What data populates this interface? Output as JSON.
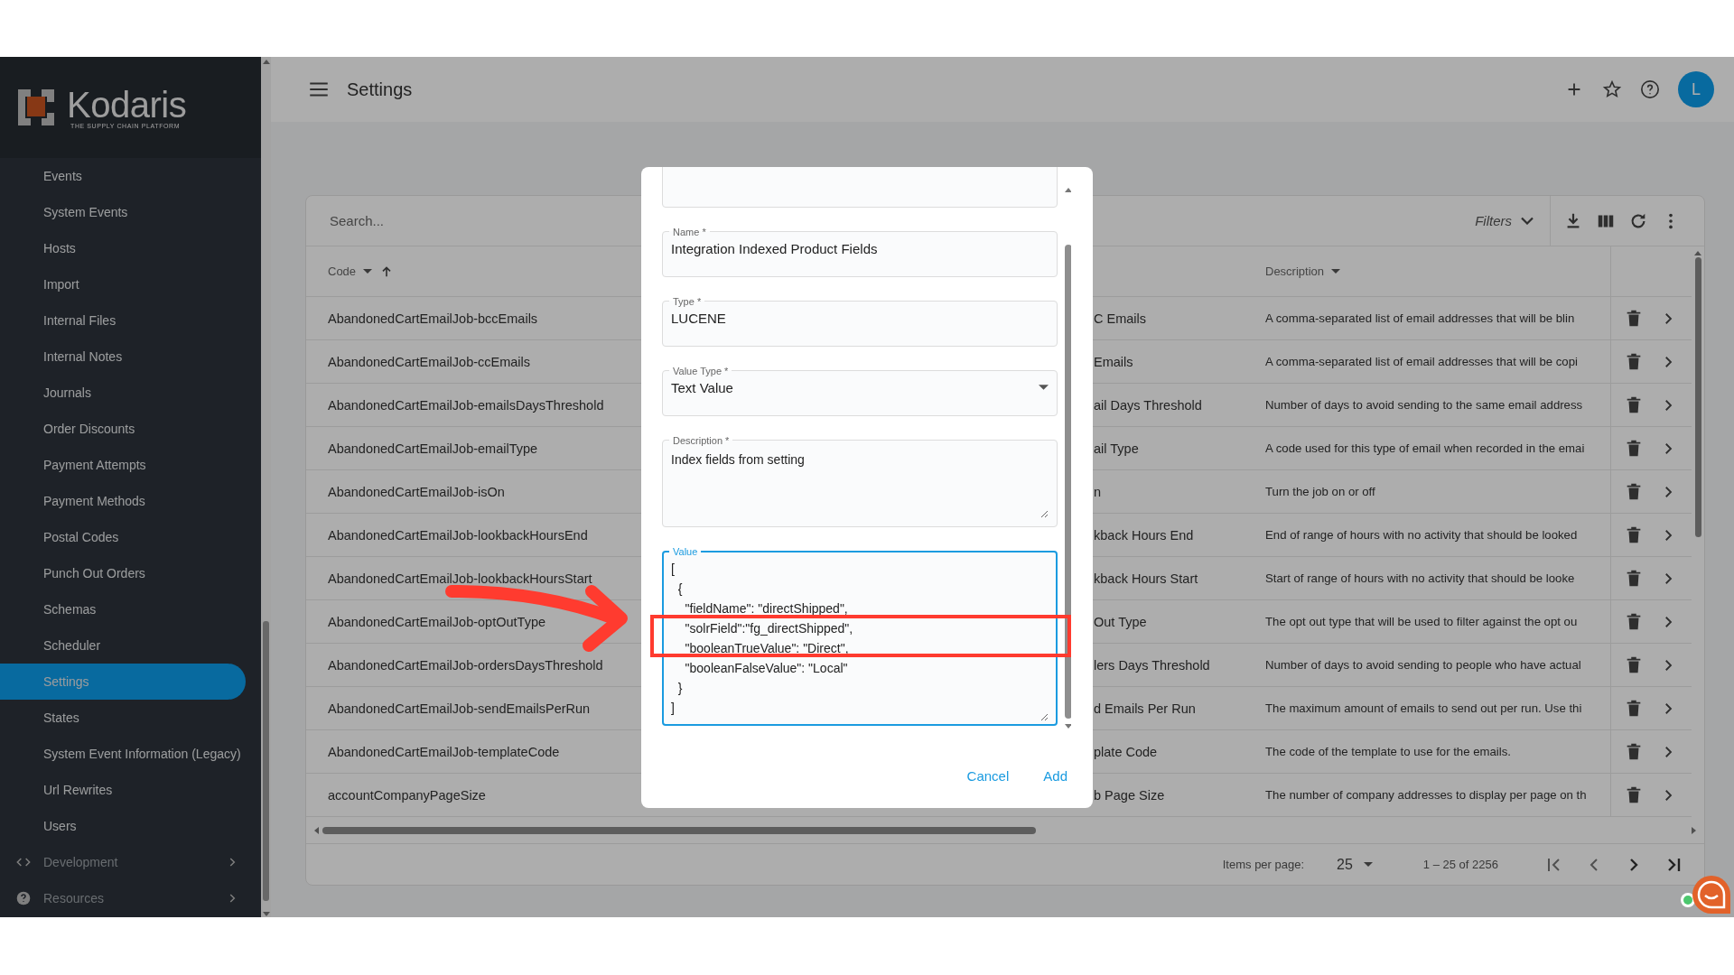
{
  "logo": {
    "name": "Kodaris",
    "tagline": "THE SUPPLY CHAIN PLATFORM"
  },
  "sidebar": {
    "items": [
      {
        "label": "Events",
        "kind": "link",
        "selected": false
      },
      {
        "label": "System Events",
        "kind": "link",
        "selected": false
      },
      {
        "label": "Hosts",
        "kind": "link",
        "selected": false
      },
      {
        "label": "Import",
        "kind": "link",
        "selected": false
      },
      {
        "label": "Internal Files",
        "kind": "link",
        "selected": false
      },
      {
        "label": "Internal Notes",
        "kind": "link",
        "selected": false
      },
      {
        "label": "Journals",
        "kind": "link",
        "selected": false
      },
      {
        "label": "Order Discounts",
        "kind": "link",
        "selected": false
      },
      {
        "label": "Payment Attempts",
        "kind": "link",
        "selected": false
      },
      {
        "label": "Payment Methods",
        "kind": "link",
        "selected": false
      },
      {
        "label": "Postal Codes",
        "kind": "link",
        "selected": false
      },
      {
        "label": "Punch Out Orders",
        "kind": "link",
        "selected": false
      },
      {
        "label": "Schemas",
        "kind": "link",
        "selected": false
      },
      {
        "label": "Scheduler",
        "kind": "link",
        "selected": false
      },
      {
        "label": "Settings",
        "kind": "link",
        "selected": true
      },
      {
        "label": "States",
        "kind": "link",
        "selected": false
      },
      {
        "label": "System Event Information (Legacy)",
        "kind": "link",
        "selected": false
      },
      {
        "label": "Url Rewrites",
        "kind": "link",
        "selected": false
      },
      {
        "label": "Users",
        "kind": "link",
        "selected": false
      },
      {
        "label": "Development",
        "kind": "code-section",
        "selected": false
      },
      {
        "label": "Resources",
        "kind": "help-section",
        "selected": false
      }
    ]
  },
  "header": {
    "title": "Settings",
    "avatar": "L"
  },
  "table": {
    "search": {
      "placeholder": "Search..."
    },
    "filters": "Filters",
    "columns": [
      {
        "label": "Code"
      },
      {
        "label": "Description"
      }
    ],
    "rows": [
      {
        "code": "AbandonedCartEmailJob-bccEmails",
        "column_2": "C Emails",
        "description": "A comma-separated list of email addresses that will be blin"
      },
      {
        "code": "AbandonedCartEmailJob-ccEmails",
        "column_2": "Emails",
        "description": "A comma-separated list of email addresses that will be copi"
      },
      {
        "code": "AbandonedCartEmailJob-emailsDaysThreshold",
        "column_2": "ail Days Threshold",
        "description": "Number of days to avoid sending to the same email address"
      },
      {
        "code": "AbandonedCartEmailJob-emailType",
        "column_2": "ail Type",
        "description": "A code used for this type of email when recorded in the emai"
      },
      {
        "code": "AbandonedCartEmailJob-isOn",
        "column_2": "n",
        "description": "Turn the job on or off"
      },
      {
        "code": "AbandonedCartEmailJob-lookbackHoursEnd",
        "column_2": "kback Hours End",
        "description": "End of range of hours with no activity that should be looked"
      },
      {
        "code": "AbandonedCartEmailJob-lookbackHoursStart",
        "column_2": "kback Hours Start",
        "description": "Start of range of hours with no activity that should be looke"
      },
      {
        "code": "AbandonedCartEmailJob-optOutType",
        "column_2": "Out Type",
        "description": "The opt out type that will be used to filter against the opt ou"
      },
      {
        "code": "AbandonedCartEmailJob-ordersDaysThreshold",
        "column_2": "lers Days Threshold",
        "description": "Number of days to avoid sending to people who have actual"
      },
      {
        "code": "AbandonedCartEmailJob-sendEmailsPerRun",
        "column_2": "d Emails Per Run",
        "description": "The maximum amount of emails to send out per run. Use thi"
      },
      {
        "code": "AbandonedCartEmailJob-templateCode",
        "column_2": "plate Code",
        "description": "The code of the template to use for the emails."
      },
      {
        "code": "accountCompanyPageSize",
        "column_2": "b Page Size",
        "description": "The number of company addresses to display per page on th"
      }
    ],
    "paginator": {
      "label": "Items per page:",
      "page_size": "25",
      "range": "1 – 25 of 2256"
    }
  },
  "dialog": {
    "fields": [
      {
        "kind": "text",
        "focused": false
      },
      {
        "kind": "text",
        "label": "Name *",
        "value": "Integration Indexed Product Fields",
        "focused": false
      },
      {
        "kind": "text",
        "label": "Type *",
        "value": "LUCENE",
        "focused": false
      },
      {
        "kind": "select",
        "label": "Value Type *",
        "value": "Text Value",
        "focused": false
      },
      {
        "kind": "textarea",
        "label": "Description *",
        "value": "Index fields from setting",
        "focused": false
      },
      {
        "kind": "code",
        "label": "Value",
        "value": "[\n  {\n    \"fieldName\": \"directShipped\",\n    \"solrField\":\"fg_directShipped\",\n    \"booleanTrueValue\": \"Direct\",\n    \"booleanFalseValue\": \"Local\"\n  }\n]",
        "focused": true
      }
    ],
    "buttons": [
      "Cancel",
      "Add"
    ]
  }
}
